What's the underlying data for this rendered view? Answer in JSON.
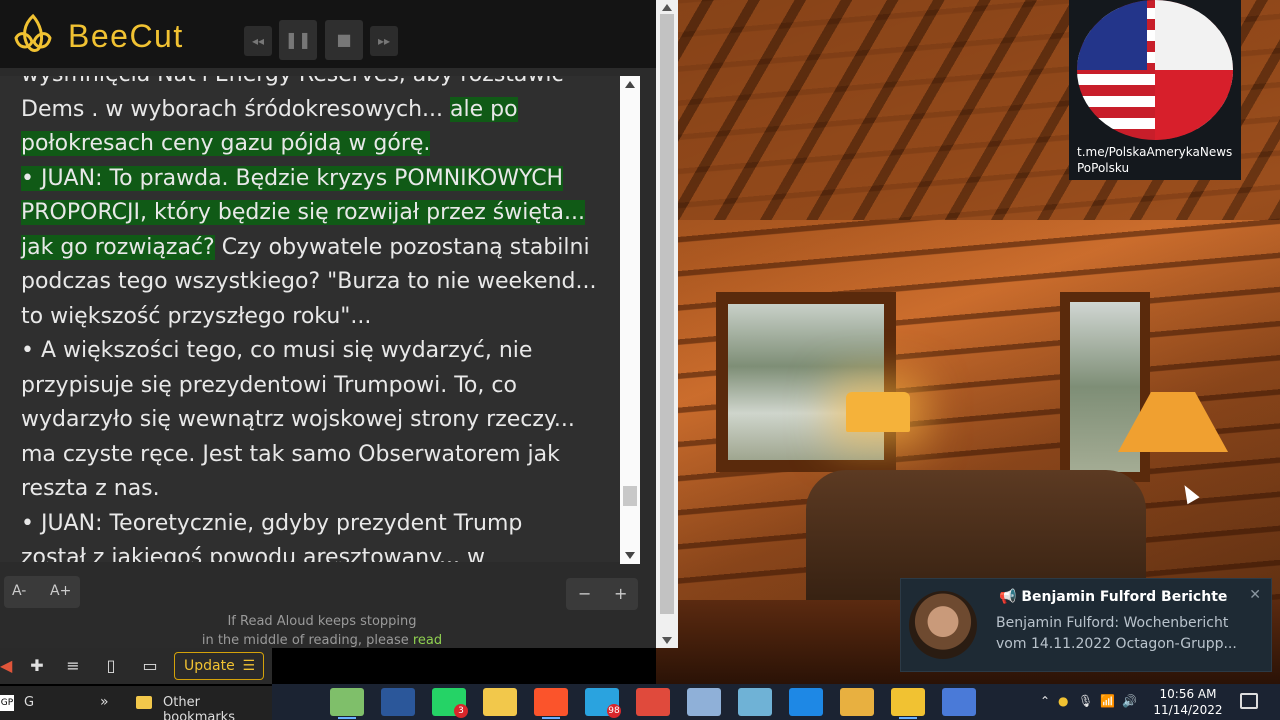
{
  "app": {
    "brand": "BeeCut"
  },
  "reader": {
    "lines": [
      {
        "text": "wyśmnięcia Nat'l Energy Reserves, aby rozstawić",
        "hl": false
      },
      {
        "parts": [
          {
            "text": "Dems . w wyborach śródokresowych... ",
            "hl": false
          },
          {
            "text": "ale po",
            "hl": true
          }
        ]
      },
      {
        "parts": [
          {
            "text": "połokresach ceny gazu pójdą w górę.",
            "hl": true
          }
        ]
      },
      {
        "parts": [
          {
            "text": "• JUAN: To prawda. Będzie kryzys POMNIKOWYCH",
            "hl": true
          }
        ]
      },
      {
        "parts": [
          {
            "text": "PROPORCJI, który będzie się rozwijał przez święta...",
            "hl": true
          }
        ]
      },
      {
        "parts": [
          {
            "text": "jak go rozwiązać?",
            "hl": true
          },
          {
            "text": " Czy obywatele pozostaną stabilni",
            "hl": false
          }
        ]
      },
      {
        "parts": [
          {
            "text": "podczas tego wszystkiego? \"Burza to nie weekend...",
            "hl": false
          }
        ]
      },
      {
        "parts": [
          {
            "text": "to większość przyszłego roku\"...",
            "hl": false
          }
        ]
      },
      {
        "parts": [
          {
            "text": "• A większości tego, co musi się wydarzyć, nie",
            "hl": false
          }
        ]
      },
      {
        "parts": [
          {
            "text": "przypisuje się prezydentowi Trumpowi. To, co",
            "hl": false
          }
        ]
      },
      {
        "parts": [
          {
            "text": "wydarzyło się wewnątrz wojskowej strony rzeczy...",
            "hl": false
          }
        ]
      },
      {
        "parts": [
          {
            "text": "ma czyste ręce. Jest tak samo Obserwatorem jak",
            "hl": false
          }
        ]
      },
      {
        "parts": [
          {
            "text": "reszta z nas.",
            "hl": false
          }
        ]
      },
      {
        "parts": [
          {
            "text": "• JUAN: Teoretycznie, gdyby prezydent Trump",
            "hl": false
          }
        ]
      },
      {
        "parts": [
          {
            "text": "został z jakiegoś powodu aresztowany... w",
            "hl": false
          }
        ]
      }
    ],
    "font_minus": "A-",
    "font_plus": "A+",
    "zoom_minus": "−",
    "zoom_plus": "+",
    "note_line1": "If Read Aloud keeps stopping",
    "note_line2": "in the middle of reading, please",
    "note_link": "read",
    "highlight_color": "#105a16"
  },
  "controls": {
    "prev": "◂◂",
    "pause": "❚❚",
    "stop": "■",
    "next": "▸▸"
  },
  "channel": {
    "link": "t.me/PolskaAmerykaNewsPoPolsku"
  },
  "browser": {
    "update_label": "Update",
    "update_menu": "☰",
    "bookmarks": {
      "gp": "GP",
      "g": "G",
      "more": "»",
      "other": "Other bookmarks"
    }
  },
  "notification": {
    "title": "Benjamin Fulford Berichte",
    "body": "Benjamin Fulford: Wochenbericht vom 14.11.2022  Octagon-Grupp...",
    "close": "✕"
  },
  "taskbar": {
    "apps": [
      {
        "name": "photos",
        "color": "#7fbf6a"
      },
      {
        "name": "word",
        "color": "#2b579a"
      },
      {
        "name": "whatsapp",
        "color": "#25d366",
        "badge": "3"
      },
      {
        "name": "file-explorer",
        "color": "#f2c84b"
      },
      {
        "name": "brave",
        "color": "#fb542b"
      },
      {
        "name": "telegram",
        "color": "#2aa3df",
        "badge": "98"
      },
      {
        "name": "app-red",
        "color": "#e04a3c"
      },
      {
        "name": "notepad",
        "color": "#8fb0d8"
      },
      {
        "name": "editor",
        "color": "#6fb2d6"
      },
      {
        "name": "video",
        "color": "#1e88e5"
      },
      {
        "name": "paint",
        "color": "#e8b040"
      },
      {
        "name": "beecut",
        "color": "#f1c232"
      },
      {
        "name": "chrome-app",
        "color": "#4a7ad8"
      }
    ],
    "time": "10:56 AM",
    "date": "11/14/2022"
  }
}
